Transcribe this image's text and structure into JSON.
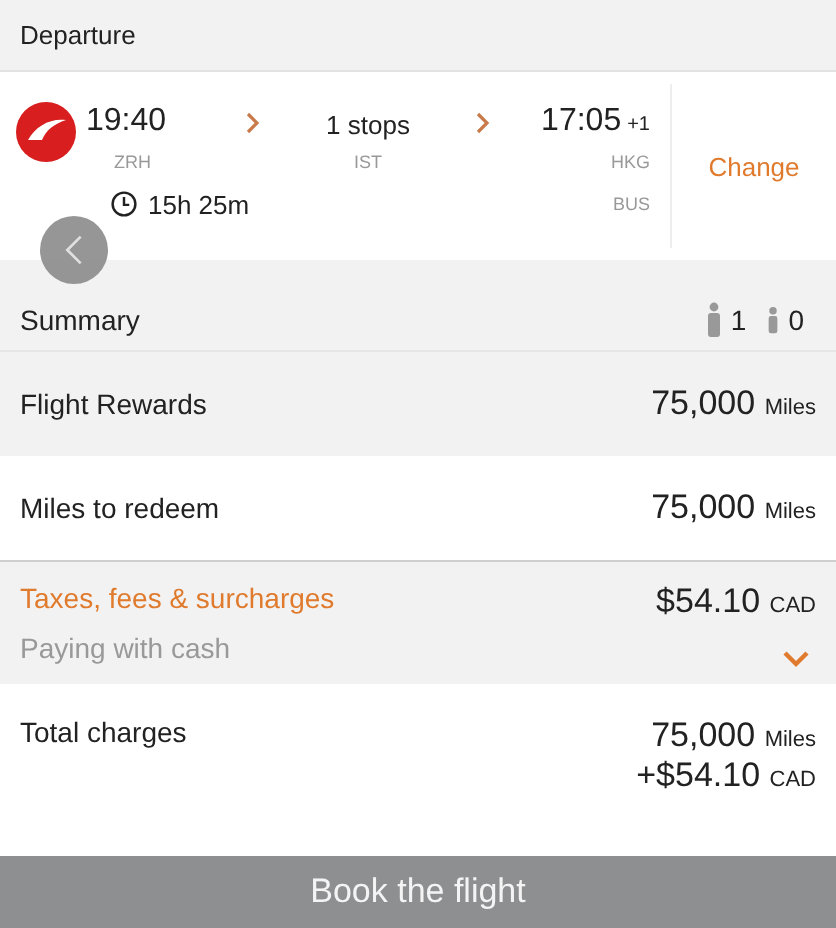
{
  "header": {
    "title": "Departure"
  },
  "flight": {
    "depart_time": "19:40",
    "origin": "ZRH",
    "stops": "1 stops",
    "via": "IST",
    "arrive_time": "17:05",
    "day_offset": "+1",
    "destination": "HKG",
    "duration": "15h 25m",
    "cabin": "BUS",
    "action": "Change"
  },
  "summary": {
    "title": "Summary",
    "adults": "1",
    "children": "0"
  },
  "rows": [
    {
      "kind": "plain",
      "label": "Flight Rewards",
      "amount": "75,000",
      "unit": "Miles"
    },
    {
      "kind": "plain",
      "label": "Miles to redeem",
      "amount": "75,000",
      "unit": "Miles"
    },
    {
      "kind": "expandable",
      "label": "Taxes, fees & surcharges",
      "sublabel": "Paying with cash",
      "amount": "$54.10",
      "unit": "CAD",
      "expanded": false
    }
  ],
  "total": {
    "label": "Total charges",
    "lines": [
      {
        "amount": "75,000",
        "unit": "Miles"
      },
      {
        "amount": "+$54.10",
        "unit": "CAD"
      }
    ]
  },
  "book_button": "Book the flight"
}
